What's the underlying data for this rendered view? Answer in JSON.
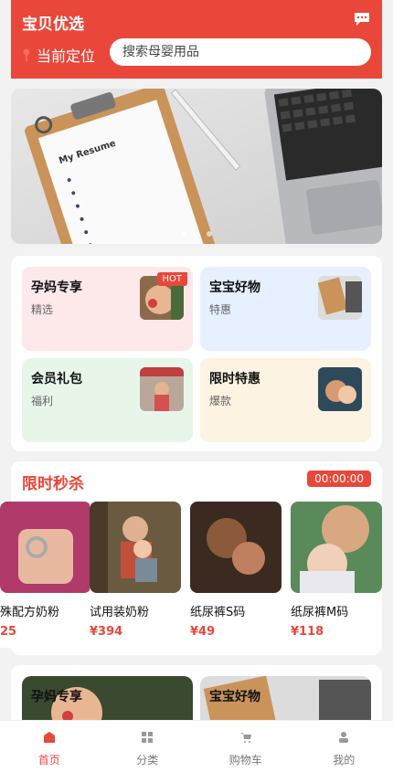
{
  "header": {
    "app_title": "宝贝优选",
    "location_label": "当前定位",
    "search_placeholder": "搜索母婴用品",
    "accent_color": "#e8473a"
  },
  "categories": [
    {
      "title": "孕妈专享",
      "subtitle": "精选",
      "badge": "HOT",
      "bg": "#fde8ea"
    },
    {
      "title": "宝宝好物",
      "subtitle": "特惠",
      "badge": "",
      "bg": "#e6f0fe"
    },
    {
      "title": "会员礼包",
      "subtitle": "福利",
      "badge": "",
      "bg": "#e8f6ea"
    },
    {
      "title": "限时特惠",
      "subtitle": "爆款",
      "badge": "",
      "bg": "#fdf3e2"
    }
  ],
  "flash_sale": {
    "title": "限时秒杀",
    "timer": "00:00:00",
    "products": [
      {
        "name": "殊配方奶粉",
        "price": "25"
      },
      {
        "name": "试用装奶粉",
        "price": "¥394"
      },
      {
        "name": "纸尿裤S码",
        "price": "¥49"
      },
      {
        "name": "纸尿裤M码",
        "price": "¥118"
      }
    ]
  },
  "bottom_cards": [
    {
      "title": "孕妈专享"
    },
    {
      "title": "宝宝好物"
    }
  ],
  "tabbar": [
    {
      "label": "首页",
      "active": true
    },
    {
      "label": "分类",
      "active": false
    },
    {
      "label": "购物车",
      "active": false
    },
    {
      "label": "我的",
      "active": false
    }
  ]
}
